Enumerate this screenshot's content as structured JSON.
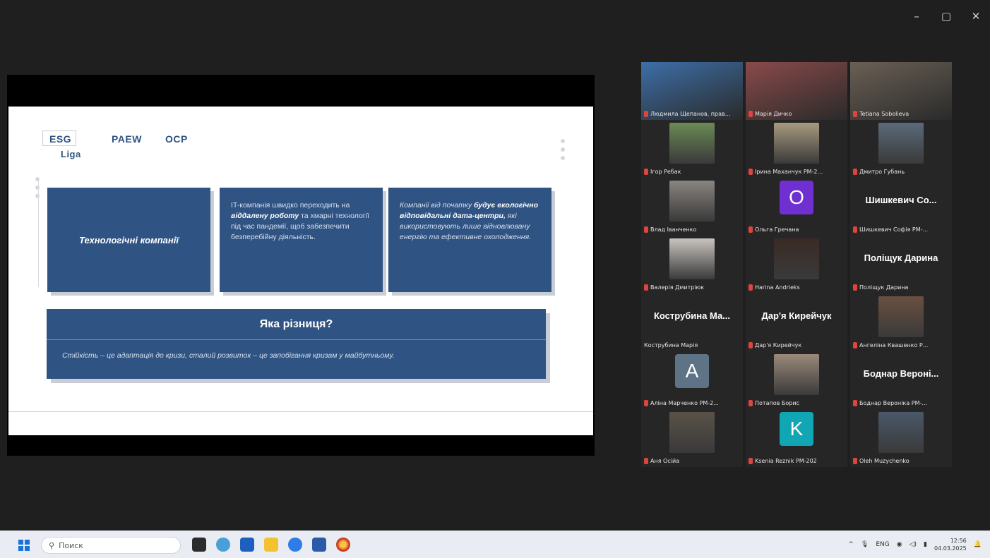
{
  "window": {
    "minimize": "–",
    "restore": "▢",
    "close": "✕"
  },
  "slide": {
    "logos": [
      "ESG",
      "Liga",
      "PAEW",
      "OCP"
    ],
    "card1_title": "Технологічні компанії",
    "card2_parts": [
      "IT-компанія швидко переходить на ",
      "віддалену роботу",
      " та хмарні технології під час пандемії, щоб забезпечити безперебійну діяльність."
    ],
    "card3_parts": [
      "Компанії від початку ",
      "будує екологічно відповідальні дата-центри,",
      " які використовують лише відновлювану енергію та ефективне охолодження."
    ],
    "diff_title": "Яка різниця?",
    "diff_text": "Стійкість – це адаптація до кризи, сталий розвиток – це запобігання кризам у майбутньому."
  },
  "participants": [
    {
      "name": "Людмила Щепанов, прав...",
      "type": "video",
      "bg": "#3d6fa8",
      "active": true
    },
    {
      "name": "Марія Дичко",
      "type": "video",
      "bg": "#8a4a4a"
    },
    {
      "name": "Tetiana Sobolieva",
      "type": "video",
      "bg": "#6a6055"
    },
    {
      "name": "Ігор Ребак",
      "type": "photo",
      "bg": "#6b8a55"
    },
    {
      "name": "Ірина Маханчук РМ-2...",
      "type": "photo",
      "bg": "#a89a80"
    },
    {
      "name": "Дмитро Губань",
      "type": "photo",
      "bg": "#5a6a7a"
    },
    {
      "name": "Влад Іванченко",
      "type": "photo",
      "bg": "#8a8580"
    },
    {
      "name": "Ольга Гречана",
      "type": "avatar",
      "letter": "O",
      "bg": "#6f2fd1"
    },
    {
      "name": "Шишкевич Софія РМ-...",
      "type": "bigname",
      "big": "Шишкевич Со..."
    },
    {
      "name": "Валерія Дмитріюк",
      "type": "photo",
      "bg": "#c9c4bf"
    },
    {
      "name": "Harina Andrieks",
      "type": "photo",
      "bg": "#3a2a25"
    },
    {
      "name": "Поліщук Дарина",
      "type": "bigname",
      "big": "Поліщук Дарина"
    },
    {
      "name": "Кострубина Марія",
      "type": "bigname",
      "big": "Кострубина Ма...",
      "nomic": true
    },
    {
      "name": "Дар'я Кирейчук",
      "type": "bigname",
      "big": "Дар'я Кирейчук"
    },
    {
      "name": "Ангеліна Квашенко Р...",
      "type": "photo",
      "bg": "#6a5040"
    },
    {
      "name": "Аліна Марченко РМ-2...",
      "type": "avatar",
      "letter": "A",
      "bg": "#5f7386"
    },
    {
      "name": "Потапов Борис",
      "type": "photo",
      "bg": "#9a8a7a"
    },
    {
      "name": "Боднар Вероніка РМ-...",
      "type": "bigname",
      "big": "Боднар Вероні..."
    },
    {
      "name": "Аня Осійа",
      "type": "photo",
      "bg": "#5a5248"
    },
    {
      "name": "Ksenia Reznik РМ-202",
      "type": "avatar",
      "letter": "K",
      "bg": "#10a6b4"
    },
    {
      "name": "Oleh Muzychenko",
      "type": "photo",
      "bg": "#4a5868"
    }
  ],
  "taskbar": {
    "search_placeholder": "Поиск",
    "lang": "ENG",
    "time": "12:56",
    "date": "04.03.2025"
  }
}
